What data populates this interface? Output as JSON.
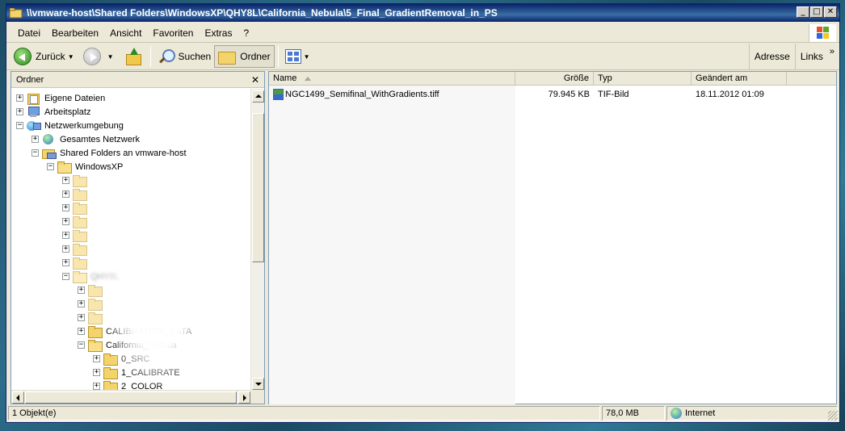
{
  "window": {
    "title": "\\\\vmware-host\\Shared Folders\\WindowsXP\\QHY8L\\California_Nebula\\5_Final_GradientRemoval_in_PS",
    "controls": {
      "minimize": "_",
      "maximize": "□",
      "close": "✕"
    }
  },
  "menu": [
    "Datei",
    "Bearbeiten",
    "Ansicht",
    "Favoriten",
    "Extras",
    "?"
  ],
  "toolbar": {
    "back_label": "Zurück",
    "search_label": "Suchen",
    "folders_label": "Ordner",
    "address_label": "Adresse",
    "links_label": "Links",
    "links_chevron": "»"
  },
  "folder_pane": {
    "header": "Ordner",
    "close_glyph": "✕",
    "tree": [
      {
        "label": "Eigene Dateien",
        "icon": "mydocs-icon",
        "expander": "+",
        "level": 0
      },
      {
        "label": "Arbeitsplatz",
        "icon": "computer-icon",
        "expander": "+",
        "level": 0
      },
      {
        "label": "Netzwerkumgebung",
        "icon": "network-icon",
        "expander": "−",
        "level": 0
      },
      {
        "label": "Gesamtes Netzwerk",
        "icon": "globe-icon",
        "expander": "+",
        "level": 1
      },
      {
        "label": "Shared Folders an vmware-host",
        "icon": "share-icon",
        "expander": "−",
        "level": 1
      },
      {
        "label": "WindowsXP",
        "icon": "folder-icon",
        "expander": "−",
        "level": 2
      },
      {
        "label": "",
        "icon": "folder-icon",
        "expander": "+",
        "level": 3,
        "blurred": true
      },
      {
        "label": "",
        "icon": "folder-icon",
        "expander": "+",
        "level": 3,
        "blurred": true
      },
      {
        "label": "",
        "icon": "folder-icon",
        "expander": "+",
        "level": 3,
        "blurred": true
      },
      {
        "label": "",
        "icon": "folder-icon",
        "expander": "+",
        "level": 3,
        "blurred": true
      },
      {
        "label": "",
        "icon": "folder-icon",
        "expander": "+",
        "level": 3,
        "blurred": true
      },
      {
        "label": "",
        "icon": "folder-icon",
        "expander": "+",
        "level": 3,
        "blurred": true
      },
      {
        "label": "",
        "icon": "folder-icon",
        "expander": "+",
        "level": 3,
        "blurred": true
      },
      {
        "label": "QHY8L",
        "icon": "folder-icon",
        "expander": "−",
        "level": 3,
        "blurred": true
      },
      {
        "label": "",
        "icon": "folder-icon",
        "expander": "+",
        "level": 4,
        "blurred": true
      },
      {
        "label": "",
        "icon": "folder-icon",
        "expander": "+",
        "level": 4,
        "blurred": true
      },
      {
        "label": "",
        "icon": "folder-icon",
        "expander": "+",
        "level": 4,
        "blurred": true
      },
      {
        "label": "CALIBRATION_DATA",
        "icon": "folder-icon",
        "expander": "+",
        "level": 4
      },
      {
        "label": "California_Nebula",
        "icon": "folder-icon",
        "expander": "−",
        "level": 4
      },
      {
        "label": "0_SRC",
        "icon": "folder-icon",
        "expander": "+",
        "level": 5
      },
      {
        "label": "1_CALIBRATE",
        "icon": "folder-icon",
        "expander": "+",
        "level": 5
      },
      {
        "label": "2_COLOR",
        "icon": "folder-icon",
        "expander": "+",
        "level": 5
      }
    ]
  },
  "file_list": {
    "columns": [
      {
        "label": "Name",
        "align": "left"
      },
      {
        "label": "Größe",
        "align": "right"
      },
      {
        "label": "Typ",
        "align": "left"
      },
      {
        "label": "Geändert am",
        "align": "left"
      },
      {
        "label": "",
        "align": "left"
      }
    ],
    "rows": [
      {
        "name": "NGC1499_Semifinal_WithGradients.tiff",
        "size": "79.945 KB",
        "type": "TIF-Bild",
        "modified": "18.11.2012 01:09"
      }
    ]
  },
  "status": {
    "count": "1 Objekt(e)",
    "size": "78,0 MB",
    "zone": "Internet"
  }
}
